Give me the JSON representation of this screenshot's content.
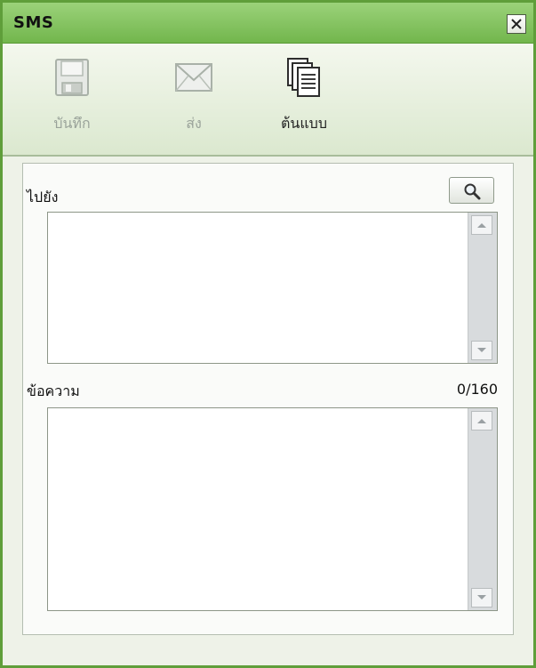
{
  "window": {
    "title": "SMS"
  },
  "toolbar": {
    "save_label": "บันทึก",
    "send_label": "ส่ง",
    "template_label": "ต้นแบบ",
    "save_icon": "floppy-disk-icon",
    "send_icon": "envelope-icon",
    "template_icon": "documents-stack-icon"
  },
  "form": {
    "to_label": "ไปยัง",
    "to_value": "",
    "message_label": "ข้อความ",
    "message_value": "",
    "char_count": "0/160",
    "search_icon": "magnifier-icon"
  },
  "colors": {
    "titlebar": "#72b64c",
    "window_border": "#5f9e3a",
    "toolbar_bg": "#dbe8cf",
    "disabled_text": "#9aa39a"
  }
}
